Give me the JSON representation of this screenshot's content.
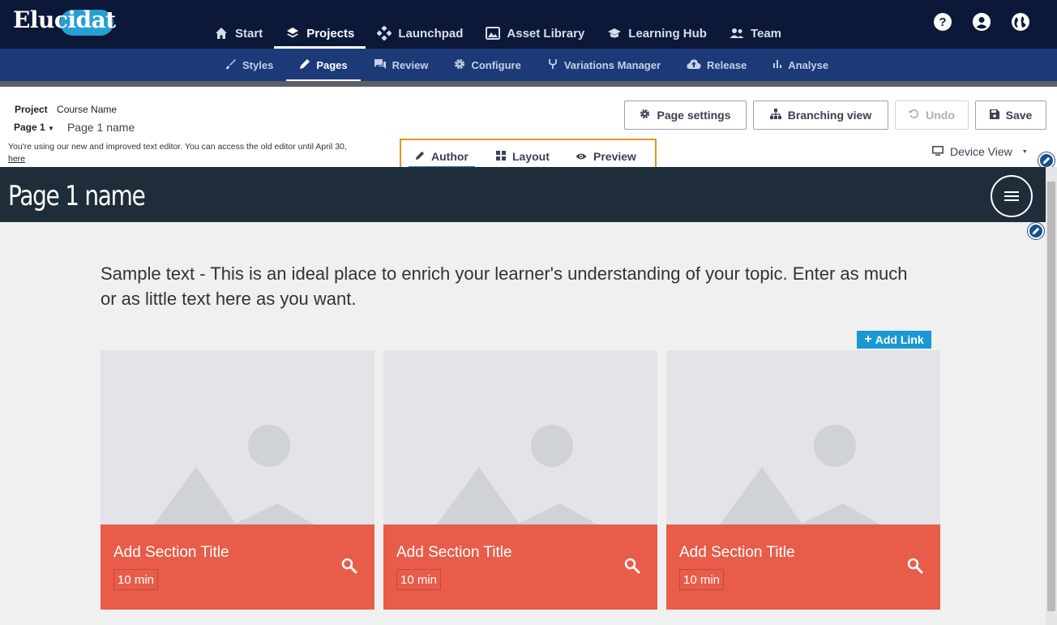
{
  "app": {
    "logo": "Elucidat"
  },
  "topnav": {
    "items": [
      {
        "label": "Start",
        "icon": "home-icon"
      },
      {
        "label": "Projects",
        "icon": "layers-icon",
        "active": true
      },
      {
        "label": "Launchpad",
        "icon": "launchpad-icon"
      },
      {
        "label": "Asset Library",
        "icon": "image-gallery-icon"
      },
      {
        "label": "Learning Hub",
        "icon": "graduation-cap-icon"
      },
      {
        "label": "Team",
        "icon": "people-icon"
      }
    ],
    "right_icons": [
      "help-icon",
      "account-icon",
      "globe-icon"
    ]
  },
  "subnav": {
    "items": [
      {
        "label": "Styles",
        "icon": "brush-icon"
      },
      {
        "label": "Pages",
        "icon": "pencil-icon",
        "active": true
      },
      {
        "label": "Review",
        "icon": "comments-icon"
      },
      {
        "label": "Configure",
        "icon": "gear-icon"
      },
      {
        "label": "Variations Manager",
        "icon": "fork-icon"
      },
      {
        "label": "Release",
        "icon": "cloud-upload-icon"
      },
      {
        "label": "Analyse",
        "icon": "bar-chart-icon"
      }
    ]
  },
  "toolbar": {
    "project_key": "Project",
    "project_name": "Course Name",
    "page_select": "Page 1",
    "page_name": "Page 1 name",
    "notice_text": "You're using our new and improved text editor. You can access the old editor until April 30, ",
    "notice_link": "here",
    "page_settings": "Page settings",
    "branching_view": "Branching view",
    "undo": "Undo",
    "save": "Save",
    "modes": [
      "Author",
      "Layout",
      "Preview"
    ],
    "active_mode": "Author",
    "device_view": "Device View"
  },
  "canvas": {
    "page_title": "Page 1 name",
    "sample_text": "Sample text - This is an ideal place to enrich your learner's understanding of your topic. Enter as much or as little text here as you want.",
    "add_link": "Add Link",
    "cards": [
      {
        "title": "Add Section Title",
        "duration": "10 min"
      },
      {
        "title": "Add Section Title",
        "duration": "10 min"
      },
      {
        "title": "Add Section Title",
        "duration": "10 min"
      }
    ]
  },
  "colors": {
    "topnav_bg": "#0c1838",
    "subnav_bg": "#1c3a78",
    "card_accent": "#e85c4a",
    "add_link_bg": "#1a98d4",
    "mode_highlight": "#e8921e"
  }
}
